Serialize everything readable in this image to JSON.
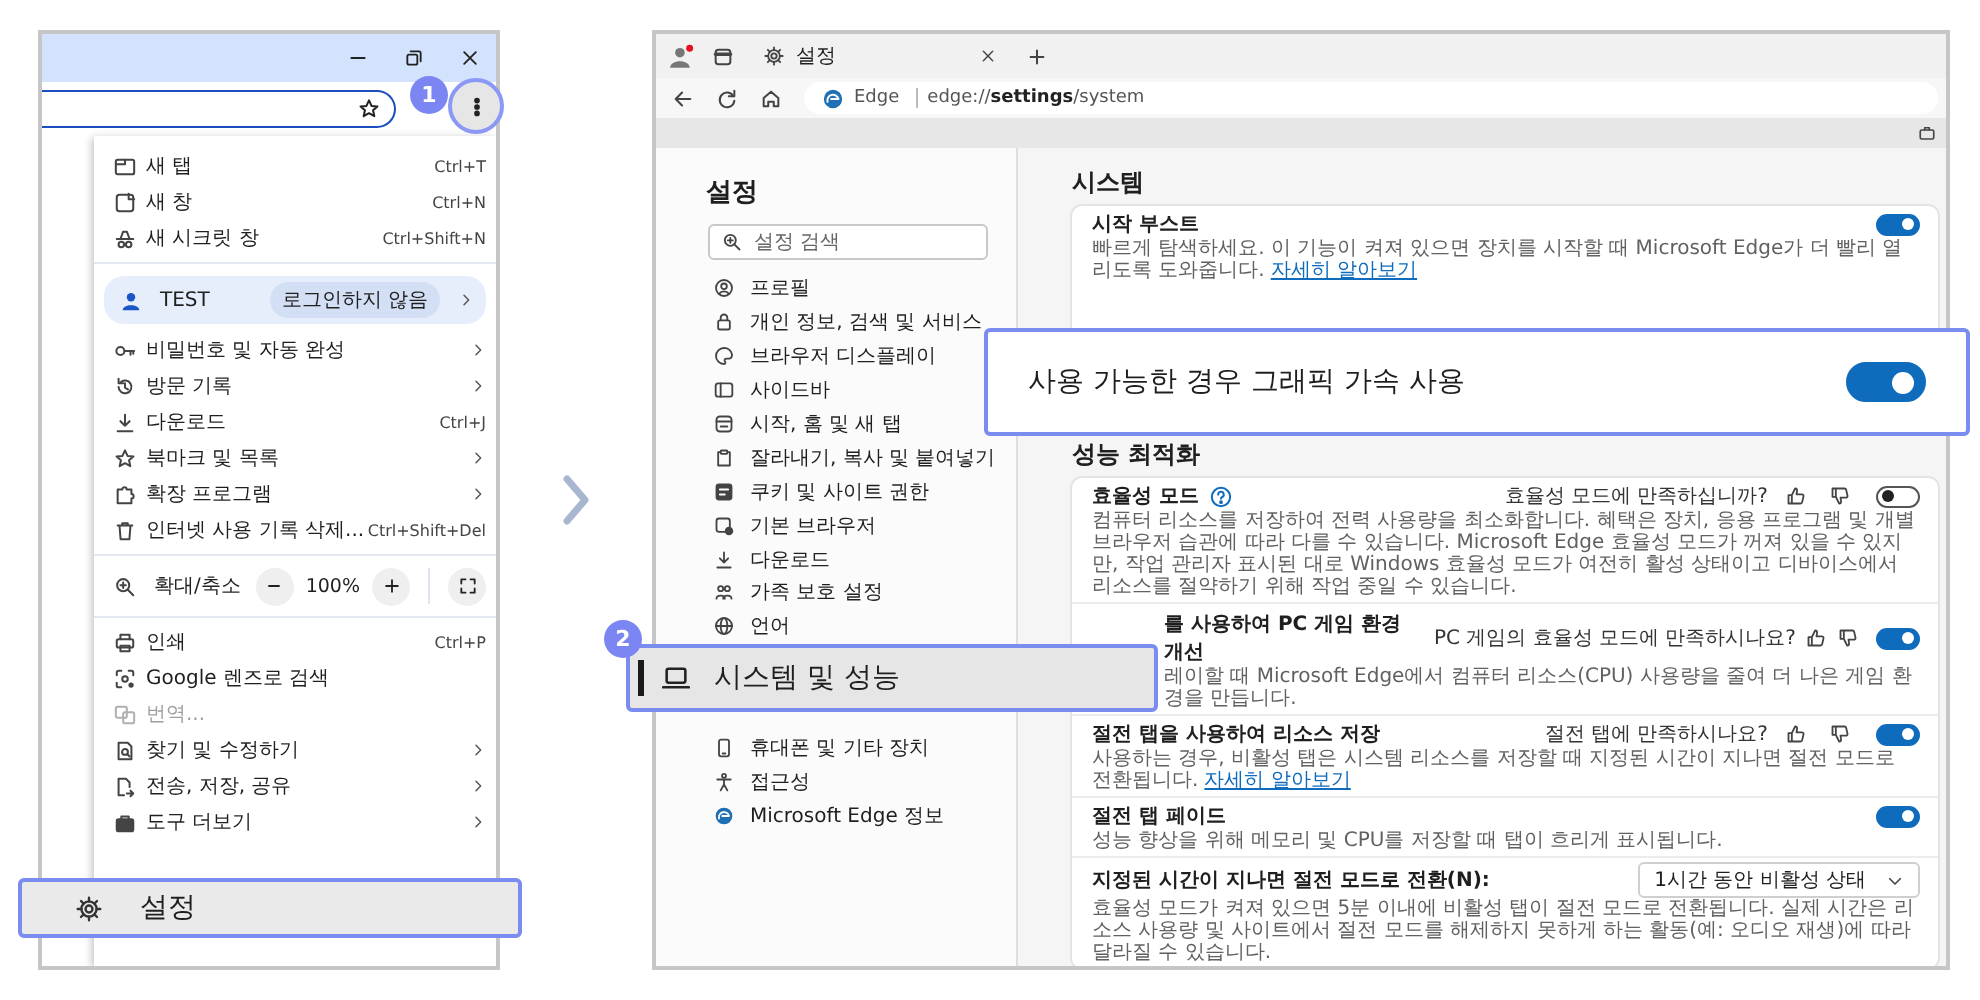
{
  "chrome": {
    "badge": "1",
    "menu": {
      "sections": [
        [
          {
            "kind": "item",
            "label": "새 탭",
            "shortcut": "Ctrl+T",
            "submenu": false,
            "disabled": false
          },
          {
            "kind": "item",
            "label": "새 창",
            "shortcut": "Ctrl+N",
            "submenu": false,
            "disabled": false
          },
          {
            "kind": "item",
            "label": "새 시크릿 창",
            "shortcut": "Ctrl+Shift+N",
            "submenu": false,
            "disabled": false
          }
        ],
        [
          {
            "kind": "profile",
            "label": "TEST",
            "badge": "로그인하지 않음",
            "submenu": true
          },
          {
            "kind": "item",
            "label": "비밀번호 및 자동 완성",
            "submenu": true,
            "disabled": false
          },
          {
            "kind": "item",
            "label": "방문 기록",
            "submenu": true,
            "disabled": false
          },
          {
            "kind": "item",
            "label": "다운로드",
            "shortcut": "Ctrl+J",
            "submenu": false,
            "disabled": false
          },
          {
            "kind": "item",
            "label": "북마크 및 목록",
            "submenu": true,
            "disabled": false
          },
          {
            "kind": "item",
            "label": "확장 프로그램",
            "submenu": true,
            "disabled": false
          },
          {
            "kind": "item",
            "label": "인터넷 사용 기록 삭제...",
            "shortcut": "Ctrl+Shift+Del",
            "submenu": false,
            "disabled": false
          }
        ],
        [
          {
            "kind": "zoom",
            "label": "확대/축소",
            "value": "100%"
          }
        ],
        [
          {
            "kind": "item",
            "label": "인쇄",
            "shortcut": "Ctrl+P",
            "submenu": false,
            "disabled": false
          },
          {
            "kind": "item",
            "label": "Google 렌즈로 검색",
            "submenu": false,
            "disabled": false
          },
          {
            "kind": "item",
            "label": "번역...",
            "submenu": false,
            "disabled": true
          },
          {
            "kind": "item",
            "label": "찾기 및 수정하기",
            "submenu": true,
            "disabled": false
          },
          {
            "kind": "item",
            "label": "전송, 저장, 공유",
            "submenu": true,
            "disabled": false
          },
          {
            "kind": "item",
            "label": "도구 더보기",
            "submenu": true,
            "disabled": false
          }
        ]
      ]
    },
    "settings_callout": {
      "label": "설정"
    }
  },
  "edge": {
    "tab": {
      "title": "설정"
    },
    "address": {
      "site": "Edge",
      "url": "edge://**settings**/system"
    },
    "sidebar": {
      "title": "설정",
      "search_placeholder": "설정 검색",
      "items_top": [
        "프로필",
        "개인 정보, 검색 및 서비스",
        "브라우저 디스플레이",
        "사이드바",
        "시작, 홈 및 새 탭",
        "잘라내기, 복사 및 붙여넣기",
        "쿠키 및 사이트 권한",
        "기본 브라우저",
        "다운로드",
        "가족 보호 설정",
        "언어"
      ],
      "items_bottom": [
        "휴대폰 및 기타 장치",
        "접근성",
        "Microsoft Edge 정보"
      ]
    },
    "main": {
      "sections": [
        {
          "title": "시스템",
          "settings": [
            {
              "kind": "toggle",
              "title": "시작 부스트",
              "help": false,
              "partly_hidden": false,
              "on": true,
              "description": "빠르게 탐색하세요. 이 기능이 켜져 있으면 장치를 시작할 때 Microsoft Edge가 더 빨리 열리도록 도와줍니다.",
              "link": "자세히 알아보기"
            }
          ]
        },
        {
          "title": "성능 최적화",
          "settings": [
            {
              "kind": "toggle",
              "title": "효율성 모드",
              "help": true,
              "partly_hidden": false,
              "feedback": "효율성 모드에 만족하십니까?",
              "on": false,
              "description": "컴퓨터 리소스를 저장하여 전력 사용량을 최소화합니다. 혜택은 장치, 응용 프로그램 및 개별 브라우저 습관에 따라 다를 수 있습니다. Microsoft Edge 효율성 모드가 꺼져 있을 수 있지만, 작업 관리자 표시된 대로 Windows 효율성 모드가 여전히 활성 상태이고 디바이스에서 리소스를 절약하기 위해 작업 중일 수 있습니다."
            },
            {
              "kind": "toggle",
              "title": "를 사용하여 PC 게임 환경 개선",
              "help": false,
              "partly_hidden": true,
              "feedback": "PC 게임의 효율성 모드에 만족하시나요?",
              "on": true,
              "description": "레이할 때 Microsoft Edge에서 컴퓨터 리소스(CPU) 사용량을 줄여 더 나은 게임 환경을 만듭니다."
            },
            {
              "kind": "toggle",
              "title": "절전 탭을 사용하여 리소스 저장",
              "help": false,
              "partly_hidden": false,
              "feedback": "절전 탭에 만족하시나요?",
              "on": true,
              "description": "사용하는 경우, 비활성 탭은 시스템 리소스를 저장할 때 지정된 시간이 지나면 절전 모드로 전환됩니다.",
              "link": "자세히 알아보기"
            },
            {
              "kind": "toggle",
              "title": "절전 탭 페이드",
              "help": false,
              "partly_hidden": false,
              "on": true,
              "description": "성능 향상을 위해 메모리 및 CPU를 저장할 때 탭이 흐리게 표시됩니다."
            },
            {
              "kind": "select",
              "title": "지정된 시간이 지나면 절전 모드로 전환(N):",
              "help": false,
              "partly_hidden": false,
              "value": "1시간 동안 비활성 상태",
              "description": "효율성 모드가 켜져 있으면 5분 이내에 비활성 탭이 절전 모드로 전환됩니다. 실제 시간은 리소스 사용량 및 사이트에서 절전 모드를 해제하지 못하게 하는 활동(예: 오디오 재생)에 따라 달라질 수 있습니다."
            }
          ]
        }
      ]
    },
    "badge": "2",
    "system_callout": {
      "label": "시스템 및 성능"
    },
    "graphics_callout": {
      "label": "사용 가능한 경우 그래픽 가속 사용",
      "on": true
    }
  }
}
